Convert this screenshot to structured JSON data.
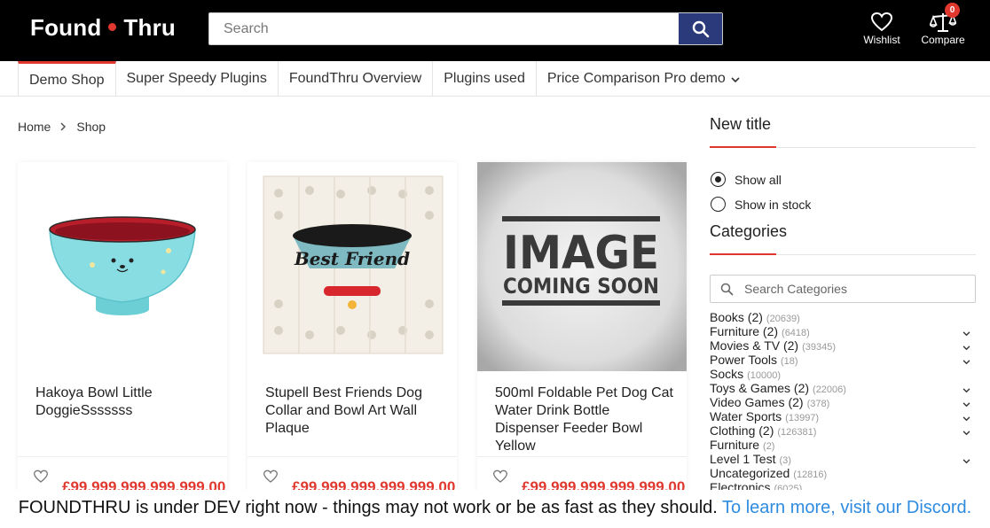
{
  "header": {
    "logo_left": "Found",
    "logo_right": "Thru",
    "search_placeholder": "Search",
    "wishlist_label": "Wishlist",
    "compare_label": "Compare",
    "compare_count": "0"
  },
  "nav": {
    "items": [
      {
        "label": "Demo Shop"
      },
      {
        "label": "Super Speedy Plugins"
      },
      {
        "label": "FoundThru Overview"
      },
      {
        "label": "Plugins used"
      },
      {
        "label": "Price Comparison Pro demo"
      }
    ]
  },
  "breadcrumb": {
    "home": "Home",
    "current": "Shop"
  },
  "products": [
    {
      "title": "Hakoya Bowl Little DoggieSssssss",
      "price": "£99,999,999,999,999.00"
    },
    {
      "title": "Stupell Best Friends Dog Collar and Bowl Art Wall Plaque",
      "price": "£99,999,999,999,999.00",
      "image_text": "Best Friend"
    },
    {
      "title": "500ml Foldable Pet Dog Cat Water Drink Bottle Dispenser Feeder Bowl Yellow",
      "price": "£99,999,999,999,999.00",
      "image_line1": "IMAGE",
      "image_line2": "COMING SOON"
    }
  ],
  "sidebar": {
    "title1": "New title",
    "show_all": "Show all",
    "show_in_stock": "Show in stock",
    "title2": "Categories",
    "cat_search_placeholder": "Search Categories",
    "categories": [
      {
        "name": "Books (2)",
        "count": "(20639)"
      },
      {
        "name": "Furniture (2)",
        "count": "(6418)"
      },
      {
        "name": "Movies & TV (2)",
        "count": "(39345)"
      },
      {
        "name": "Power Tools",
        "count": "(18)"
      },
      {
        "name": "Socks",
        "count": "(10000)"
      },
      {
        "name": "Toys & Games (2)",
        "count": "(22006)"
      },
      {
        "name": "Video Games (2)",
        "count": "(378)"
      },
      {
        "name": "Water Sports",
        "count": "(13997)"
      },
      {
        "name": "Clothing (2)",
        "count": "(126381)"
      },
      {
        "name": "Furniture",
        "count": "(2)"
      },
      {
        "name": "Level 1 Test",
        "count": "(3)"
      },
      {
        "name": "Uncategorized",
        "count": "(12816)"
      },
      {
        "name": "Electronics",
        "count": "(6025)"
      }
    ]
  },
  "notice": {
    "text": "FOUNDTHRU is under DEV right now - things may not work or be as fast as they should.",
    "link": "To learn more, visit our Discord."
  },
  "colors": {
    "accent": "#e0382e",
    "search_button": "#2a3a7a",
    "link": "#2f8be0"
  }
}
